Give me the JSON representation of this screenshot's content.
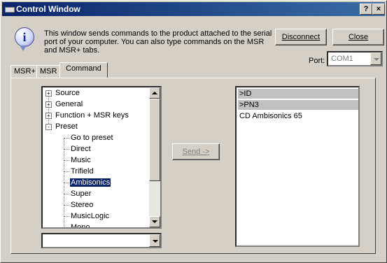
{
  "window": {
    "title": "Control Window",
    "help_glyph": "?",
    "close_glyph": "×"
  },
  "info": {
    "icon_glyph": "i",
    "line1": "This window sends commands to the product attached to the serial",
    "line2": "port of your computer. You can also type commands on the MSR",
    "line3": "and MSR+ tabs."
  },
  "buttons": {
    "disconnect": "Disconnect",
    "close": "Close",
    "send": "Send ->"
  },
  "port": {
    "label": "Port:",
    "value": "COM1"
  },
  "tabs": [
    {
      "label": "MSR+"
    },
    {
      "label": "MSR"
    },
    {
      "label": "Command",
      "active": true
    }
  ],
  "tree": {
    "items": [
      {
        "label": "Source",
        "expander": "+"
      },
      {
        "label": "General",
        "expander": "+"
      },
      {
        "label": "Function + MSR keys",
        "expander": "+"
      },
      {
        "label": "Preset",
        "expander": "-"
      },
      {
        "label": "Go to preset"
      },
      {
        "label": "Direct"
      },
      {
        "label": "Music"
      },
      {
        "label": "Trifield"
      },
      {
        "label": "Ambisonics",
        "selected": true
      },
      {
        "label": "Super"
      },
      {
        "label": "Stereo"
      },
      {
        "label": "MusicLogic"
      },
      {
        "label": "Mono"
      }
    ]
  },
  "command_combo": {
    "value": ""
  },
  "output": {
    "lines": [
      {
        "text": ">ID",
        "highlight": true
      },
      {
        "text": ">PN3",
        "highlight": true
      },
      {
        "text": "CD   Ambisonics  65",
        "highlight": false
      }
    ]
  }
}
